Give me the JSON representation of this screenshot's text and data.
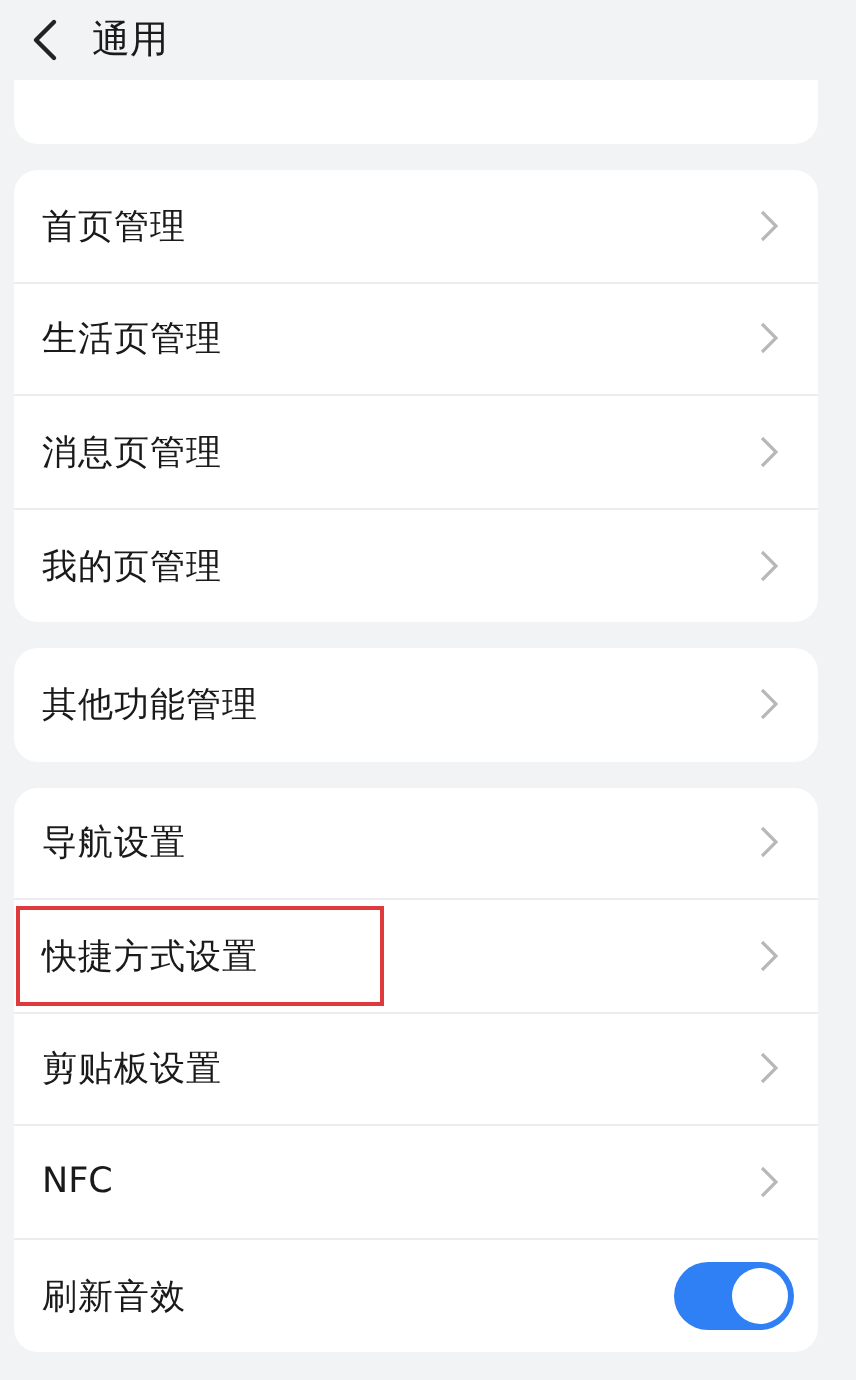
{
  "header": {
    "title": "通用"
  },
  "groups": [
    {
      "items": [
        {
          "kind": "link",
          "label": "首页管理",
          "highlighted": false
        },
        {
          "kind": "link",
          "label": "生活页管理",
          "highlighted": false
        },
        {
          "kind": "link",
          "label": "消息页管理",
          "highlighted": false
        },
        {
          "kind": "link",
          "label": "我的页管理",
          "highlighted": false
        }
      ]
    },
    {
      "items": [
        {
          "kind": "link",
          "label": "其他功能管理",
          "highlighted": false
        }
      ]
    },
    {
      "items": [
        {
          "kind": "link",
          "label": "导航设置",
          "highlighted": false
        },
        {
          "kind": "link",
          "label": "快捷方式设置",
          "highlighted": true
        },
        {
          "kind": "link",
          "label": "剪贴板设置",
          "highlighted": false
        },
        {
          "kind": "link",
          "label": "NFC",
          "highlighted": false
        },
        {
          "kind": "toggle",
          "label": "刷新音效",
          "on": true
        }
      ]
    }
  ]
}
